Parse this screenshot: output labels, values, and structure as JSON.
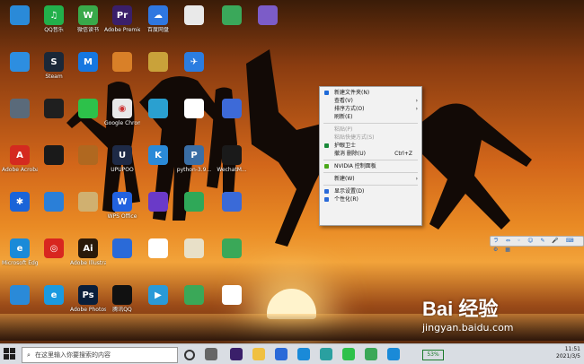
{
  "desktop": {
    "icons": [
      {
        "label": "",
        "color": "#2a8ad8",
        "glyph": ""
      },
      {
        "label": "QQ音乐",
        "color": "#22b04b",
        "glyph": "♫"
      },
      {
        "label": "微信读书",
        "color": "#39a94a",
        "glyph": "W"
      },
      {
        "label": "Adobe Premiere",
        "color": "#3a1f6a",
        "glyph": "Pr"
      },
      {
        "label": "百度网盘",
        "color": "#2f77e0",
        "glyph": "☁"
      },
      {
        "label": "",
        "color": "#e9e9e9",
        "glyph": ""
      },
      {
        "label": "",
        "color": "#3aa85a",
        "glyph": ""
      },
      {
        "label": "",
        "color": "#7c5cc8",
        "glyph": ""
      },
      {
        "label": "",
        "color": "#2d8ee0",
        "glyph": ""
      },
      {
        "label": "Steam",
        "color": "#1b2838",
        "glyph": "S"
      },
      {
        "label": "",
        "color": "#1677e0",
        "glyph": "M"
      },
      {
        "label": "",
        "color": "#d98028",
        "glyph": ""
      },
      {
        "label": "",
        "color": "#c9a23a",
        "glyph": ""
      },
      {
        "label": "",
        "color": "#2b7de0",
        "glyph": "✈"
      },
      {
        "label": "",
        "color": "#5a6a7a",
        "glyph": ""
      },
      {
        "label": "",
        "color": "#1f1f1f",
        "glyph": ""
      },
      {
        "label": "",
        "color": "#2dc14a",
        "glyph": ""
      },
      {
        "label": "Google Chrome",
        "color": "#e8e8e8",
        "glyph": "◉"
      },
      {
        "label": "",
        "color": "#2aa0d0",
        "glyph": ""
      },
      {
        "label": "",
        "color": "#ffffff",
        "glyph": ""
      },
      {
        "label": "",
        "color": "#3d6ad8",
        "glyph": ""
      },
      {
        "label": "Adobe Acrobat DC",
        "color": "#d42a1f",
        "glyph": "A"
      },
      {
        "label": "",
        "color": "#1a1a1a",
        "glyph": ""
      },
      {
        "label": "",
        "color": "#b06820",
        "glyph": ""
      },
      {
        "label": "UPUPOO",
        "color": "#1e2a46",
        "glyph": "U"
      },
      {
        "label": "",
        "color": "#2a8ad8",
        "glyph": "K"
      },
      {
        "label": "python-3.9...",
        "color": "#3a6ea5",
        "glyph": "P"
      },
      {
        "label": "WechatM...",
        "color": "#1a1a1a",
        "glyph": ""
      },
      {
        "label": "",
        "color": "#1a64d8",
        "glyph": "✱"
      },
      {
        "label": "",
        "color": "#2a7fd8",
        "glyph": ""
      },
      {
        "label": "",
        "color": "#d0b070",
        "glyph": ""
      },
      {
        "label": "WPS Office",
        "color": "#2262e0",
        "glyph": "W"
      },
      {
        "label": "",
        "color": "#6a3ac8",
        "glyph": ""
      },
      {
        "label": "",
        "color": "#2fa858",
        "glyph": ""
      },
      {
        "label": "",
        "color": "#3a6ad8",
        "glyph": ""
      },
      {
        "label": "Microsoft Edge",
        "color": "#1a8ad8",
        "glyph": "e"
      },
      {
        "label": "",
        "color": "#d8261f",
        "glyph": "◎"
      },
      {
        "label": "Adobe Illustrator",
        "color": "#2b1a0a",
        "glyph": "Ai"
      },
      {
        "label": "",
        "color": "#2a6ad8",
        "glyph": ""
      },
      {
        "label": "",
        "color": "#ffffff",
        "glyph": ""
      },
      {
        "label": "",
        "color": "#e8e0c8",
        "glyph": ""
      },
      {
        "label": "",
        "color": "#3aa858",
        "glyph": ""
      },
      {
        "label": "",
        "color": "#2a8ad8",
        "glyph": ""
      },
      {
        "label": "",
        "color": "#1a9ae0",
        "glyph": "e"
      },
      {
        "label": "Adobe Photoshop",
        "color": "#0a1e3a",
        "glyph": "Ps"
      },
      {
        "label": "腾讯QQ",
        "color": "#111111",
        "glyph": ""
      },
      {
        "label": "",
        "color": "#2a9ad8",
        "glyph": "▶"
      },
      {
        "label": "",
        "color": "#3aa858",
        "glyph": ""
      },
      {
        "label": "",
        "color": "#ffffff",
        "glyph": ""
      }
    ]
  },
  "context_menu": {
    "items": [
      {
        "label": "新建文件夹(N)",
        "shortcut": "",
        "arrow": "",
        "disabled": false,
        "icon": "#1e6ad8"
      },
      {
        "label": "查看(V)",
        "shortcut": "",
        "arrow": "›",
        "disabled": false,
        "icon": ""
      },
      {
        "label": "排序方式(O)",
        "shortcut": "",
        "arrow": "›",
        "disabled": false,
        "icon": ""
      },
      {
        "label": "刷新(E)",
        "shortcut": "",
        "arrow": "",
        "disabled": false,
        "icon": ""
      },
      {
        "sep": true
      },
      {
        "label": "粘贴(P)",
        "shortcut": "",
        "arrow": "",
        "disabled": true,
        "icon": ""
      },
      {
        "label": "粘贴快捷方式(S)",
        "shortcut": "",
        "arrow": "",
        "disabled": true,
        "icon": ""
      },
      {
        "label": "护眼卫士",
        "shortcut": "",
        "arrow": "",
        "disabled": false,
        "icon": "#1a8a3a"
      },
      {
        "label": "撤消 删除(U)",
        "shortcut": "Ctrl+Z",
        "arrow": "",
        "disabled": false,
        "icon": ""
      },
      {
        "sep": true
      },
      {
        "label": "NVIDIA 控制面板",
        "shortcut": "",
        "arrow": "",
        "disabled": false,
        "icon": "#4aa81a"
      },
      {
        "sep": true
      },
      {
        "label": "新建(W)",
        "shortcut": "",
        "arrow": "›",
        "disabled": false,
        "icon": ""
      },
      {
        "sep": true
      },
      {
        "label": "显示设置(D)",
        "shortcut": "",
        "arrow": "",
        "disabled": false,
        "icon": "#2a6ad8"
      },
      {
        "label": "个性化(R)",
        "shortcut": "",
        "arrow": "",
        "disabled": false,
        "icon": "#2a6ad8"
      }
    ]
  },
  "floating_toolbar": {
    "text": "ラ ⇔ ◦ ☺ ✎ 🎤 ⌨ ⚙ ▦"
  },
  "taskbar": {
    "search_placeholder": "在这里输入你要搜索的内容",
    "battery": "53%",
    "time": "11:51",
    "date": "2021/3/5"
  },
  "watermark": {
    "logo": "Bai 经验",
    "url": "jingyan.baidu.com"
  }
}
